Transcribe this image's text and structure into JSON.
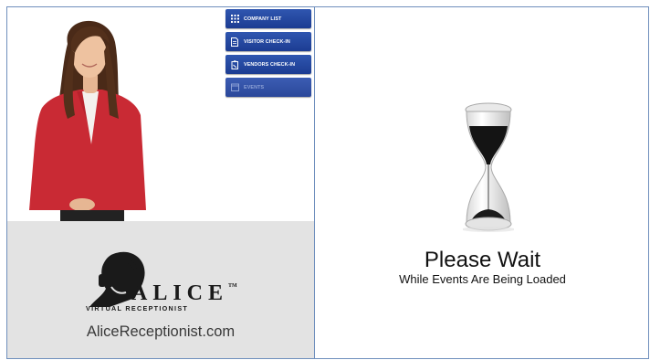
{
  "menu": {
    "items": [
      {
        "label": "COMPANY LIST",
        "icon": "grid-icon",
        "enabled": true
      },
      {
        "label": "VISITOR CHECK-IN",
        "icon": "document-icon",
        "enabled": true
      },
      {
        "label": "VENDORS CHECK-IN",
        "icon": "clipboard-icon",
        "enabled": true
      },
      {
        "label": "EVENTS",
        "icon": "calendar-icon",
        "enabled": false
      }
    ]
  },
  "branding": {
    "logo_word": "ALICE",
    "trademark": "TM",
    "logo_tagline": "VIRTUAL RECEPTIONIST",
    "website": "AliceReceptionist.com"
  },
  "status": {
    "title": "Please Wait",
    "message": "While Events Are Being Loaded",
    "icon": "hourglass-icon"
  },
  "colors": {
    "button_blue": "#1f4199",
    "branding_bg": "#e3e3e3",
    "border": "#6f8fbd"
  }
}
